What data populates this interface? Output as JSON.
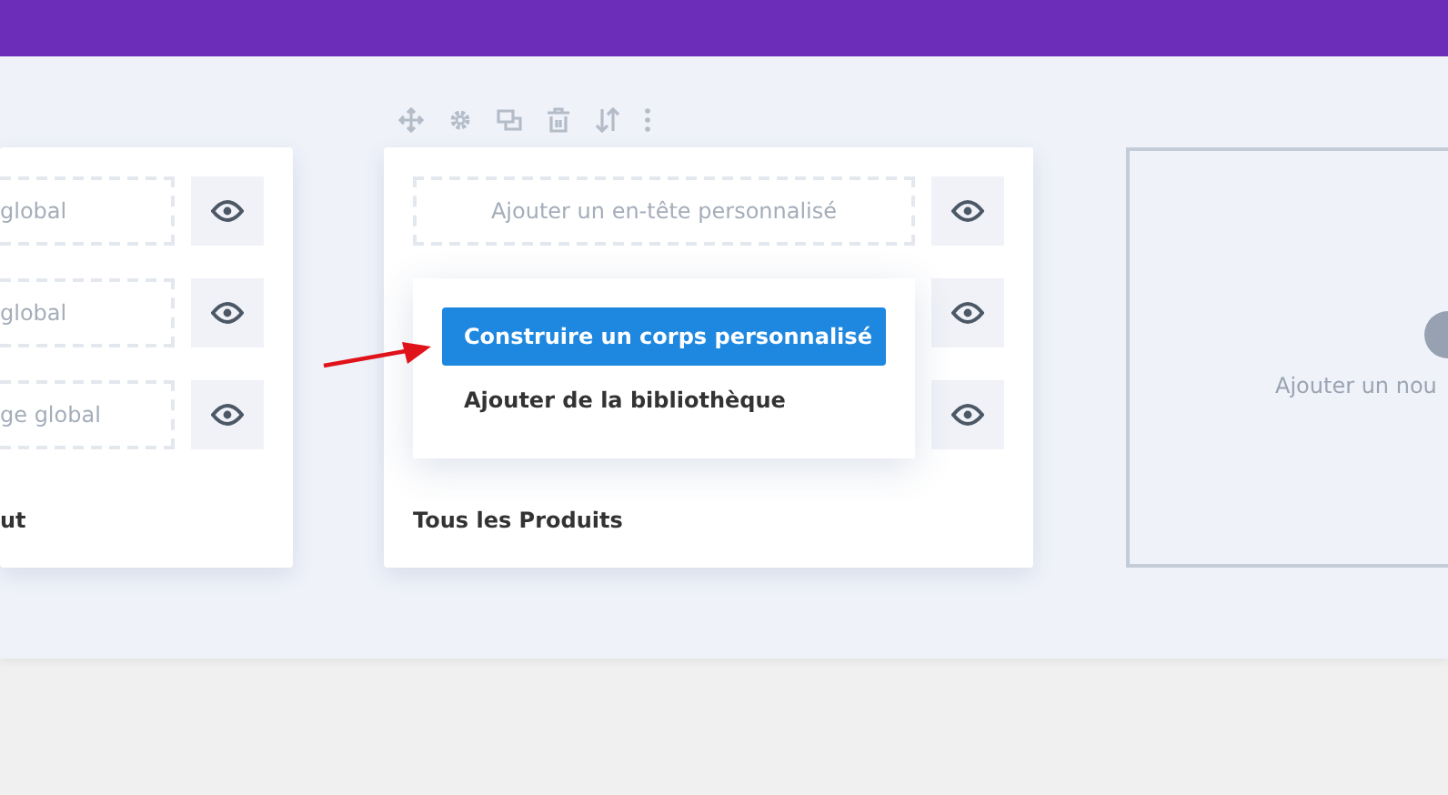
{
  "left_card": {
    "rows": [
      {
        "label": "global"
      },
      {
        "label": "global"
      },
      {
        "label": "ge global"
      }
    ],
    "title": "ut"
  },
  "center_card": {
    "rows": [
      {
        "label": "Ajouter un en-tête personnalisé"
      },
      {
        "hidden_by_menu": true
      },
      {
        "hidden_by_menu": true
      }
    ],
    "title": "Tous les Produits",
    "menu": [
      {
        "label": "Construire un corps personnalisé",
        "selected": true
      },
      {
        "label": "Ajouter de la bibliothèque",
        "selected": false
      }
    ]
  },
  "add_card": {
    "label": "Ajouter un nou"
  }
}
